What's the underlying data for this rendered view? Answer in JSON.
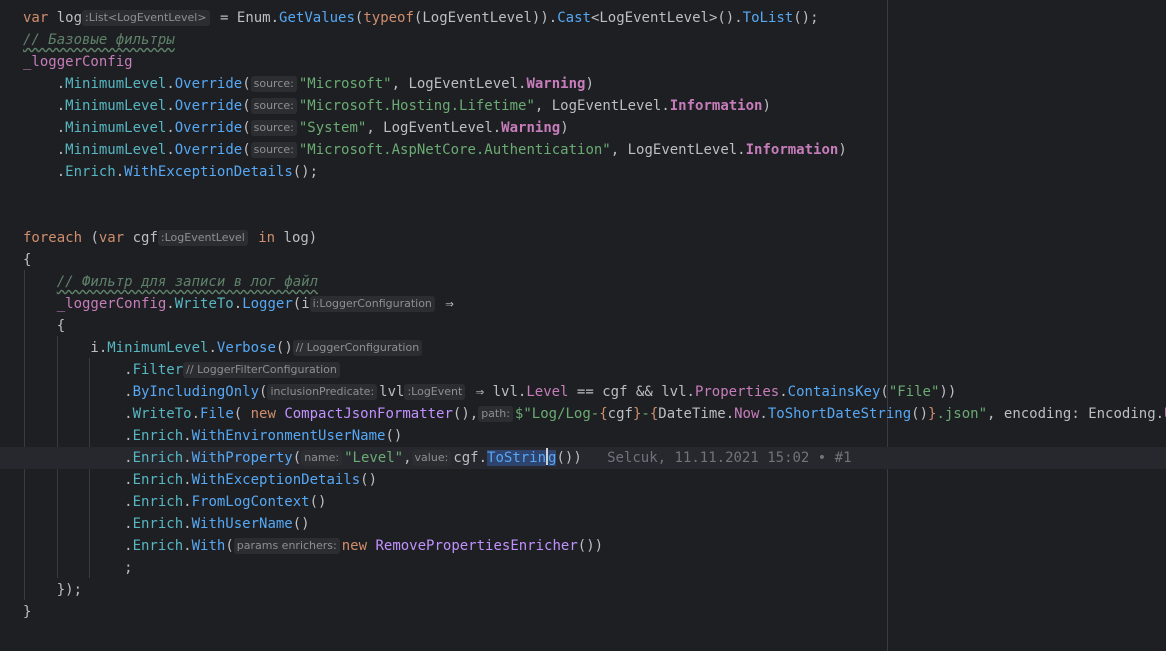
{
  "editor": {
    "blame": "Selcuk, 11.11.2021 15:02 • #1",
    "hints": {
      "list_type": ":List<LogEventLevel>",
      "source": "source:",
      "cgf_type": ":LogEventLevel",
      "i_type": "i:LoggerConfiguration",
      "logger_config": "// LoggerConfiguration",
      "filter_config": "// LoggerFilterConfiguration",
      "inclusion_predicate": "inclusionPredicate:",
      "lvl_type": ":LogEvent",
      "path": "path:",
      "name": "name:",
      "value": "value:",
      "params_enrichers": "params enrichers:"
    },
    "comments": {
      "base_filters": "// Базовые фильтры",
      "log_file_filter": "// Фильтр для записи в лог файл"
    }
  }
}
